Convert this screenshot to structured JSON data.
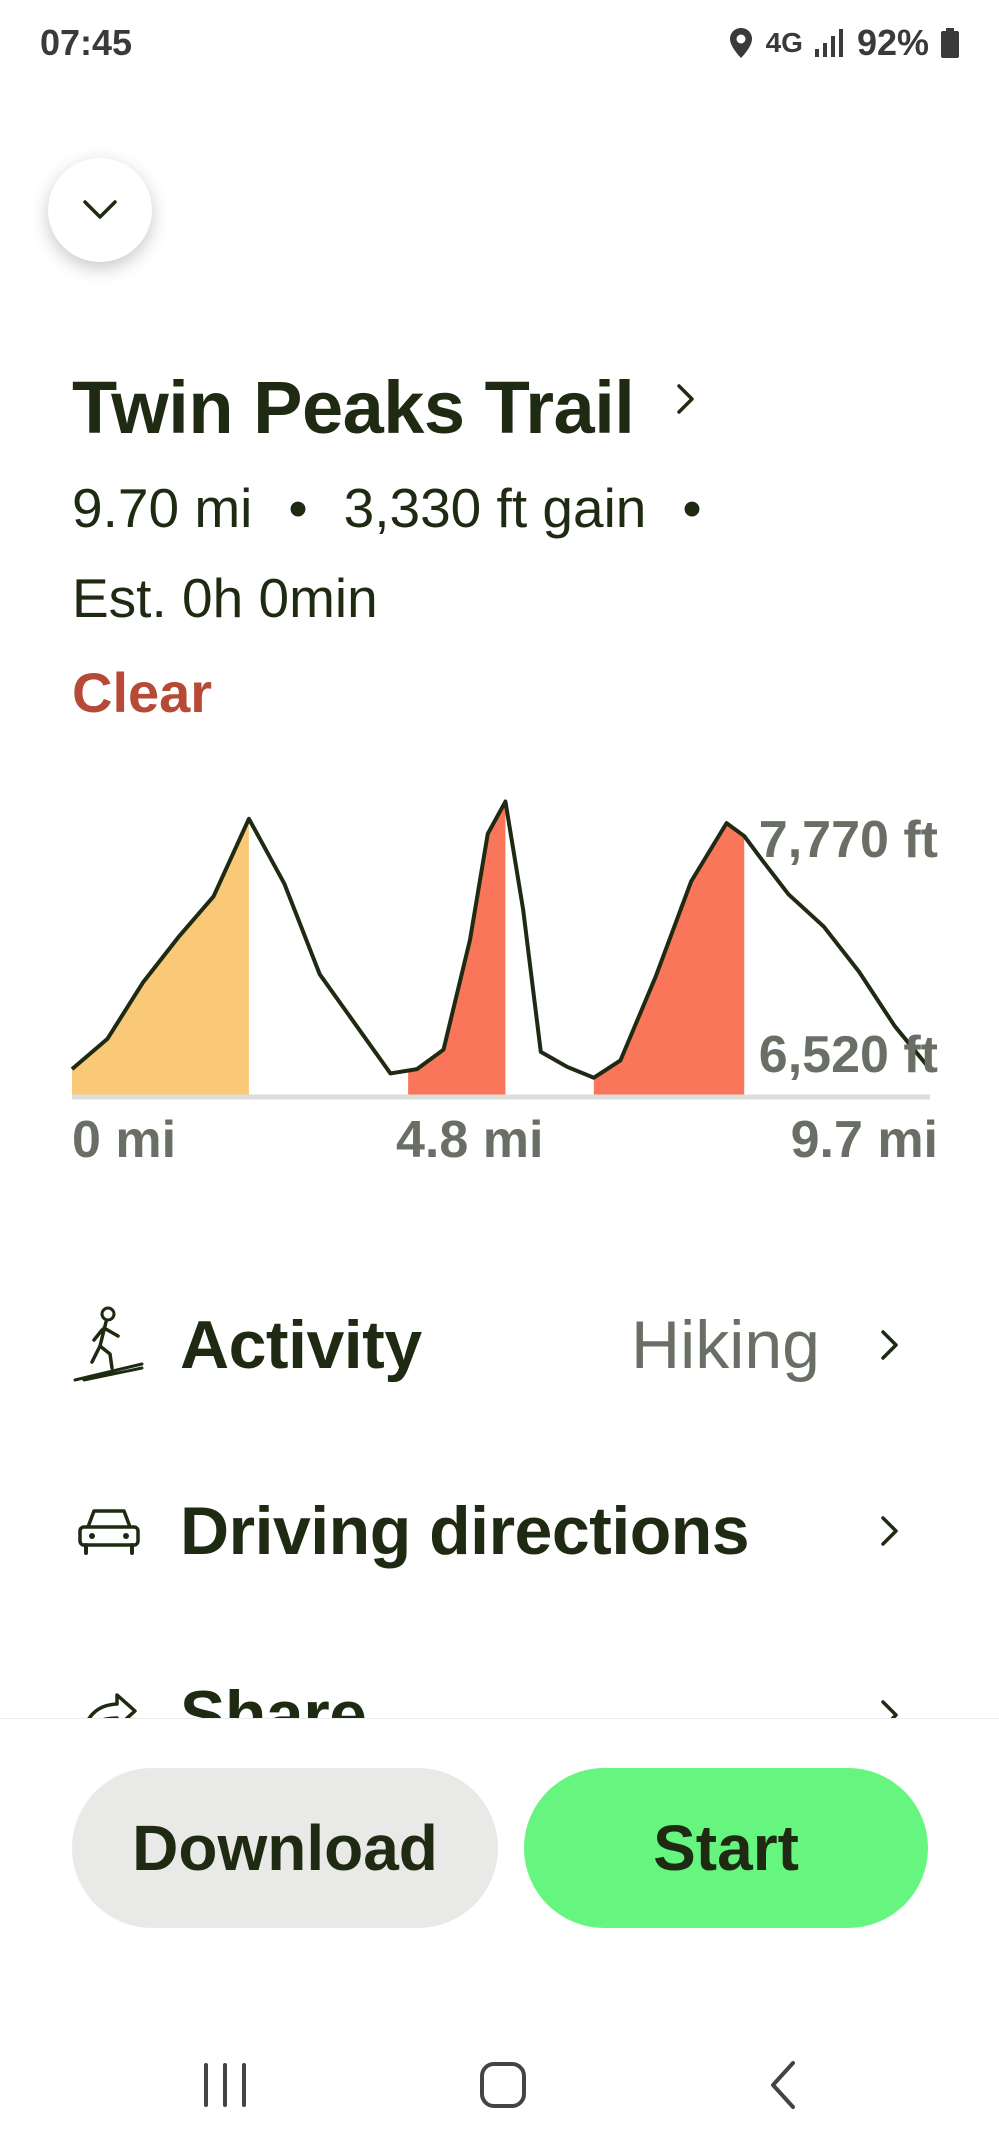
{
  "status": {
    "time": "07:45",
    "network": "4G",
    "battery": "92%"
  },
  "trail": {
    "name": "Twin Peaks Trail",
    "distance": "9.70 mi",
    "gain": "3,330 ft gain",
    "separator": "•",
    "estimate": "Est. 0h 0min",
    "condition": "Clear"
  },
  "chart_data": {
    "type": "area",
    "x_unit": "mi",
    "y_unit": "ft",
    "x": [
      0.0,
      0.4,
      0.8,
      1.2,
      1.6,
      2.0,
      2.4,
      2.8,
      3.2,
      3.6,
      3.9,
      4.2,
      4.5,
      4.7,
      4.9,
      5.1,
      5.3,
      5.6,
      5.9,
      6.2,
      6.6,
      7.0,
      7.4,
      7.6,
      7.8,
      8.1,
      8.5,
      8.9,
      9.3,
      9.7
    ],
    "y": [
      6560,
      6700,
      6960,
      7170,
      7360,
      7720,
      7420,
      7000,
      6770,
      6540,
      6560,
      6650,
      7160,
      7650,
      7800,
      7300,
      6640,
      6570,
      6520,
      6600,
      6990,
      7430,
      7700,
      7640,
      7530,
      7370,
      7220,
      7010,
      6760,
      6560
    ],
    "segments": [
      {
        "from": 0.0,
        "to": 2.0,
        "color": "#f9c977"
      },
      {
        "from": 3.8,
        "to": 4.9,
        "color": "#f9765a"
      },
      {
        "from": 5.9,
        "to": 7.6,
        "color": "#f9765a"
      }
    ],
    "line_color": "#1f2a12",
    "max_label": "7,770 ft",
    "min_label": "6,520 ft",
    "x_tick_labels": [
      "0 mi",
      "4.8 mi",
      "9.7 mi"
    ],
    "xlim": [
      0,
      9.7
    ],
    "ylim": [
      6520,
      7770
    ]
  },
  "rows": [
    {
      "label": "Activity",
      "value": "Hiking",
      "icon": "hiking-icon"
    },
    {
      "label": "Driving directions",
      "value": "",
      "icon": "car-icon"
    },
    {
      "label": "Share",
      "value": "",
      "icon": "share-icon"
    }
  ],
  "actions": {
    "download": "Download",
    "start": "Start"
  }
}
